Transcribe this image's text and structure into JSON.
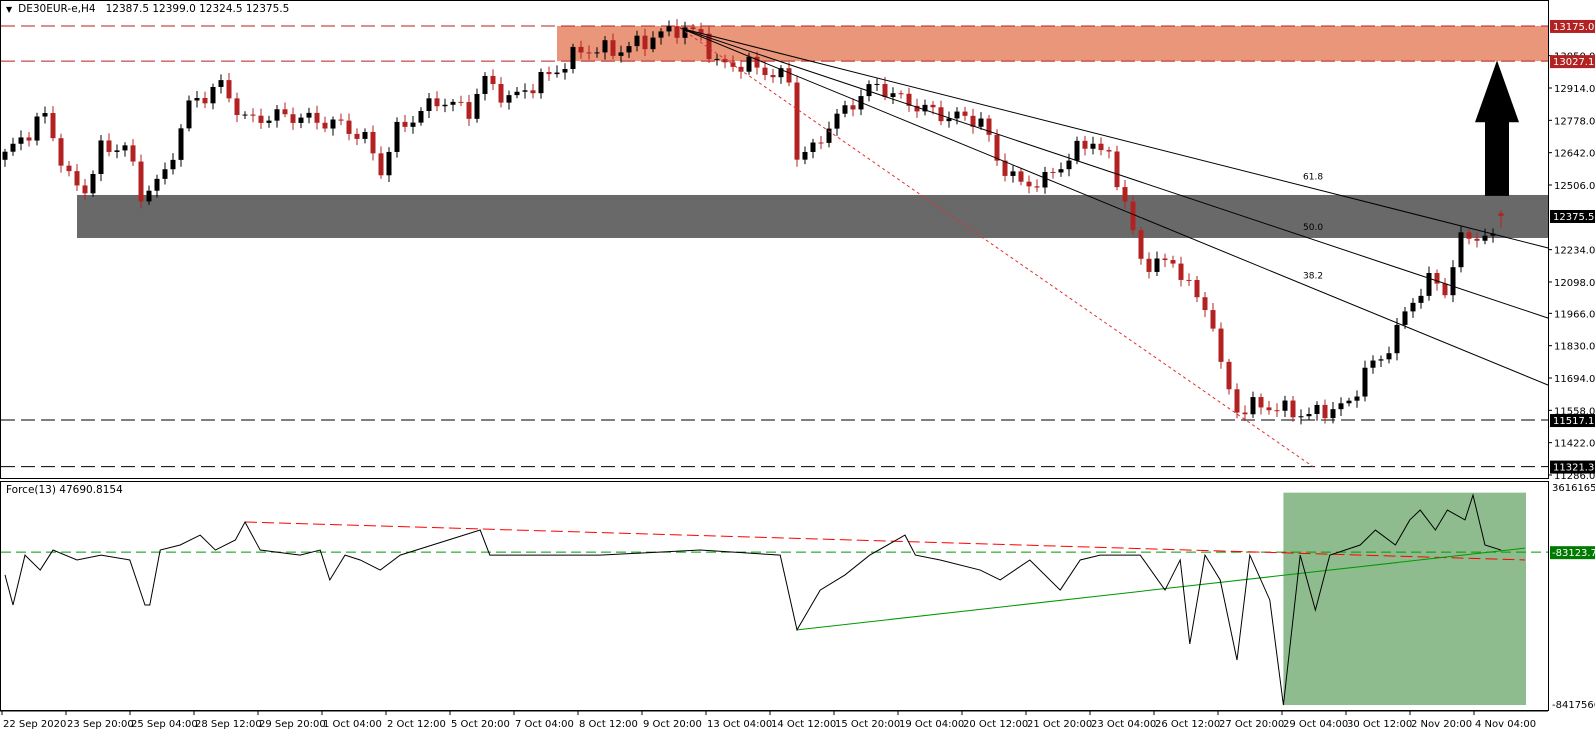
{
  "header": {
    "symbol": "DE30EUR-e,H4",
    "ohlc": "12387.5 12399.0 12324.5 12375.5",
    "menu_icon": "triangle-down-icon"
  },
  "indicator": {
    "label": "Force(13) 47690.8154",
    "axis_top": "3616165.5",
    "axis_bottom": "-8417566.",
    "current_tag": "-83123.76"
  },
  "colors": {
    "bull": "#000000",
    "bear": "#b22222",
    "resistance_zone": "#e9967a",
    "support_zone": "#696969",
    "force_zone": "#8fbc8f",
    "red_tag": "#b22222",
    "green_tag": "#007a00"
  },
  "chart_data": {
    "type": "candlestick",
    "title": "DE30EUR-e,H4",
    "bar_count": 188,
    "close_waypoints": [
      [
        0,
        12632
      ],
      [
        5,
        12800
      ],
      [
        8,
        12527
      ],
      [
        10,
        12485
      ],
      [
        12,
        12653
      ],
      [
        15,
        12674
      ],
      [
        17,
        12464
      ],
      [
        20,
        12548
      ],
      [
        23,
        12842
      ],
      [
        27,
        12927
      ],
      [
        30,
        12779
      ],
      [
        35,
        12800
      ],
      [
        42,
        12758
      ],
      [
        45,
        12700
      ],
      [
        47,
        12569
      ],
      [
        49,
        12737
      ],
      [
        54,
        12864
      ],
      [
        58,
        12821
      ],
      [
        60,
        12948
      ],
      [
        63,
        12864
      ],
      [
        69,
        12990
      ],
      [
        72,
        13074
      ],
      [
        77,
        13074
      ],
      [
        84,
        13166
      ],
      [
        87,
        13137
      ],
      [
        89,
        13011
      ],
      [
        93,
        13011
      ],
      [
        98,
        12948
      ],
      [
        99,
        12632
      ],
      [
        101,
        12653
      ],
      [
        103,
        12758
      ],
      [
        107,
        12885
      ],
      [
        109,
        12927
      ],
      [
        112,
        12864
      ],
      [
        117,
        12800
      ],
      [
        122,
        12779
      ],
      [
        124,
        12611
      ],
      [
        127,
        12506
      ],
      [
        130,
        12527
      ],
      [
        132,
        12590
      ],
      [
        134,
        12653
      ],
      [
        136,
        12695
      ],
      [
        138,
        12611
      ],
      [
        140,
        12443
      ],
      [
        142,
        12169
      ],
      [
        144,
        12190
      ],
      [
        147,
        12148
      ],
      [
        149,
        12022
      ],
      [
        151,
        11938
      ],
      [
        152,
        11728
      ],
      [
        154,
        11559
      ],
      [
        157,
        11580
      ],
      [
        160,
        11559
      ],
      [
        163,
        11538
      ],
      [
        165,
        11559
      ],
      [
        168,
        11580
      ],
      [
        170,
        11728
      ],
      [
        172,
        11770
      ],
      [
        174,
        11896
      ],
      [
        176,
        12022
      ],
      [
        178,
        12106
      ],
      [
        180,
        12064
      ],
      [
        182,
        12275
      ],
      [
        184,
        12296
      ],
      [
        186,
        12275
      ],
      [
        187,
        12375.5
      ]
    ],
    "last_bar": {
      "open": 12387.5,
      "high": 12399.0,
      "low": 12324.5,
      "close": 12375.5
    },
    "y_axis_ticks": [
      "13050.0",
      "12914.0",
      "12778.0",
      "12642.0",
      "12506.0",
      "12234.0",
      "12098.0",
      "11966.0",
      "11830.0",
      "11694.0",
      "11558.0",
      "11422.0",
      "11286.0"
    ],
    "price_tags": [
      {
        "label": "13175.0",
        "price": 13175.0,
        "style": "red"
      },
      {
        "label": "13027.1",
        "price": 13027.1,
        "style": "red"
      },
      {
        "label": "12375.5",
        "price": 12375.5,
        "style": "black"
      },
      {
        "label": "11517.1",
        "price": 11517.1,
        "style": "black"
      },
      {
        "label": "11321.3",
        "price": 11321.3,
        "style": "black"
      }
    ],
    "resistance_zone": {
      "from_bar": 69,
      "low": 13027.1,
      "high": 13175.0
    },
    "support_zone": {
      "from_bar": 9,
      "low": 12283,
      "high": 12464
    },
    "dashed_levels_red": [
      13175.0,
      13027.1
    ],
    "dashed_levels_black": [
      11517.1,
      11321.3
    ],
    "fib_fan": {
      "start": [
        84.4,
        13166
      ],
      "lines": [
        {
          "label": "61.8",
          "end": [
            192.9,
            12241
          ],
          "label_bar": 163
        },
        {
          "label": "50.0",
          "end": [
            192.9,
            11946
          ],
          "label_bar": 163
        },
        {
          "label": "38.2",
          "end": [
            192.9,
            11664
          ],
          "label_bar": 163
        }
      ]
    },
    "red_dotted_trend": {
      "start": [
        84.4,
        13166
      ],
      "end": [
        163.5,
        11321
      ]
    },
    "arrow": {
      "direction": "up",
      "bar": 186.5,
      "from": 12460,
      "to": 13030
    },
    "x_axis_labels": [
      "22 Sep 2020",
      "23 Sep 20:00",
      "25 Sep 04:00",
      "28 Sep 12:00",
      "29 Sep 20:00",
      "1 Oct 04:00",
      "2 Oct 12:00",
      "5 Oct 20:00",
      "7 Oct 04:00",
      "8 Oct 12:00",
      "9 Oct 20:00",
      "13 Oct 04:00",
      "14 Oct 12:00",
      "15 Oct 20:00",
      "19 Oct 04:00",
      "20 Oct 12:00",
      "21 Oct 20:00",
      "23 Oct 04:00",
      "26 Oct 12:00",
      "27 Oct 20:00",
      "29 Oct 04:00",
      "30 Oct 12:00",
      "2 Nov 20:00",
      "4 Nov 04:00"
    ],
    "force": {
      "name": "Force(13)",
      "units": "millions",
      "range": [
        -8.417566,
        3.6161655
      ],
      "waypoints": [
        [
          0,
          -1.3
        ],
        [
          1,
          -2.91
        ],
        [
          2.5,
          -0.24
        ],
        [
          4.4,
          -1.04
        ],
        [
          6,
          0.03
        ],
        [
          9,
          -0.5
        ],
        [
          12,
          -0.24
        ],
        [
          15.6,
          -0.5
        ],
        [
          17.5,
          -2.91
        ],
        [
          18.1,
          -2.91
        ],
        [
          19.4,
          0.03
        ],
        [
          21.9,
          0.3
        ],
        [
          24.4,
          0.83
        ],
        [
          26.3,
          0.03
        ],
        [
          28.8,
          0.57
        ],
        [
          30,
          1.53
        ],
        [
          31.9,
          0.03
        ],
        [
          36.9,
          -0.24
        ],
        [
          39.4,
          0.03
        ],
        [
          40.6,
          -1.57
        ],
        [
          42.5,
          -0.24
        ],
        [
          44.4,
          -0.5
        ],
        [
          46.9,
          -1.04
        ],
        [
          49.4,
          -0.24
        ],
        [
          59.4,
          1.1
        ],
        [
          60.6,
          -0.24
        ],
        [
          74.4,
          -0.24
        ],
        [
          86.9,
          0.03
        ],
        [
          96.9,
          -0.24
        ],
        [
          99,
          -4.24
        ],
        [
          101.9,
          -2.11
        ],
        [
          105,
          -1.3
        ],
        [
          108.1,
          -0.24
        ],
        [
          112.5,
          0.83
        ],
        [
          113.8,
          -0.24
        ],
        [
          116.9,
          -0.5
        ],
        [
          121.9,
          -1.04
        ],
        [
          124.4,
          -1.57
        ],
        [
          128.1,
          -0.5
        ],
        [
          131.9,
          -2.11
        ],
        [
          134.4,
          -0.5
        ],
        [
          136.9,
          -0.24
        ],
        [
          141.9,
          -0.24
        ],
        [
          145,
          -2.11
        ],
        [
          146.9,
          -0.5
        ],
        [
          148.1,
          -4.99
        ],
        [
          150,
          -0.24
        ],
        [
          151.9,
          -1.57
        ],
        [
          154,
          -5.85
        ],
        [
          155.6,
          -0.24
        ],
        [
          158.1,
          -2.64
        ],
        [
          159.8,
          -8.26
        ],
        [
          161.9,
          -0.24
        ],
        [
          163.8,
          -3.18
        ],
        [
          165.6,
          -0.24
        ],
        [
          169.4,
          0.3
        ],
        [
          171.3,
          1.1
        ],
        [
          173.8,
          0.3
        ],
        [
          175.6,
          1.64
        ],
        [
          176.9,
          2.17
        ],
        [
          178.8,
          1.1
        ],
        [
          180.3,
          2.17
        ],
        [
          182.5,
          1.64
        ],
        [
          183.5,
          2.97
        ],
        [
          185,
          0.3
        ],
        [
          187,
          0.03
        ]
      ],
      "zero_level": -0.08312376,
      "red_dashed_trend": {
        "start": [
          30,
          1.53
        ],
        "end": [
          190,
          -0.5
        ]
      },
      "green_trend": {
        "start": [
          99,
          -4.24
        ],
        "end": [
          190,
          0.13
        ]
      },
      "highlight_zone": {
        "from_bar": 159.8,
        "low": -8.26,
        "high": 3.1
      }
    }
  }
}
